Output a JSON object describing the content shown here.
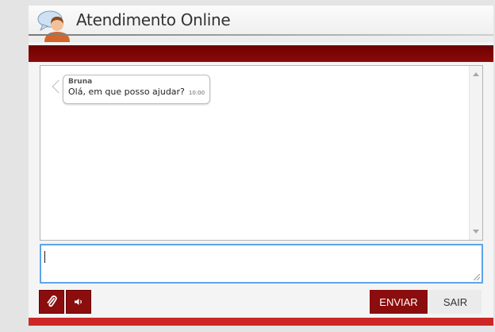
{
  "header": {
    "title": "Atendimento Online",
    "logo_icon": "support-agent-icon"
  },
  "chat": {
    "messages": [
      {
        "sender": "Bruna",
        "text": "Olá, em que posso ajudar?",
        "time": "10:00"
      }
    ]
  },
  "input": {
    "value": ""
  },
  "toolbar": {
    "attach_icon": "paperclip-icon",
    "sound_icon": "speaker-icon",
    "send_label": "ENVIAR",
    "exit_label": "SAIR"
  },
  "colors": {
    "header_bar": "#7a0000",
    "accent": "#8b0d0d",
    "footer_bar": "#cd2626",
    "input_focus": "#5ea3e8"
  }
}
